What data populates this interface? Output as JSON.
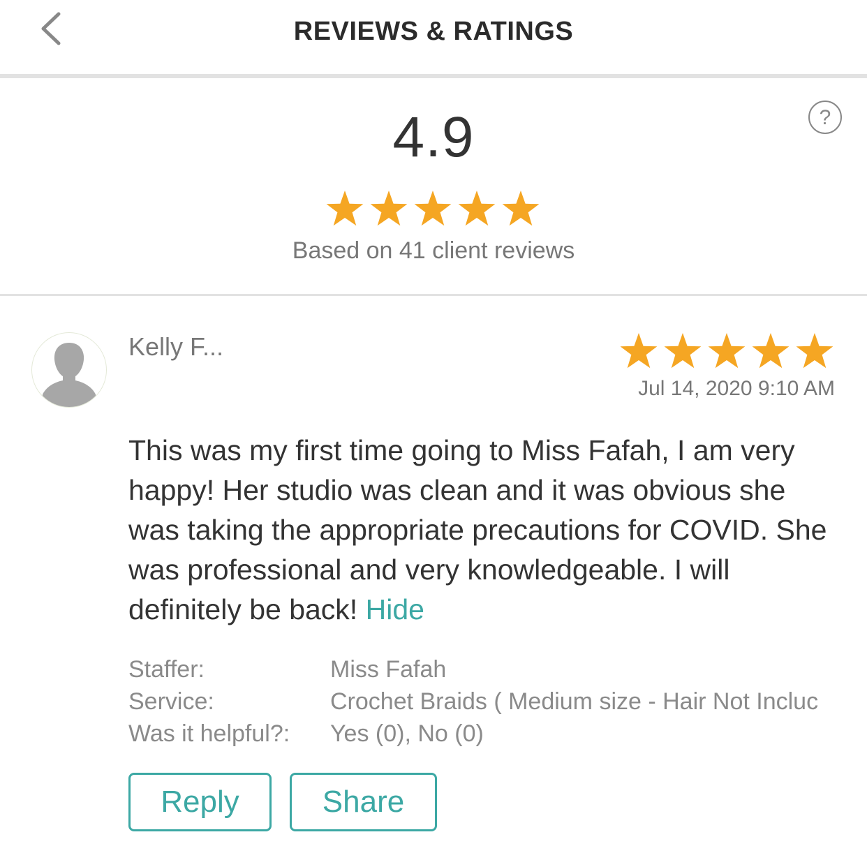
{
  "header": {
    "title": "REVIEWS & RATINGS",
    "back_icon": "chevron-left-icon",
    "title_color": "#2b2b2b"
  },
  "summary": {
    "average_rating": "4.9",
    "stars": 5,
    "caption": "Based on 41 client reviews",
    "help_icon": "question-circle-icon",
    "star_color": "#f5a623"
  },
  "review": {
    "reviewer": "Kelly F...",
    "avatar_icon": "default-avatar-icon",
    "stars": 5,
    "date": "Jul 14, 2020 9:10 AM",
    "body": "This was my first time going to Miss Fafah, I am very happy!  Her studio was clean and it was obvious she was taking the appropriate precautions for COVID.  She was professional and very knowledgeable.  I will definitely be back!",
    "toggle_link": "Hide",
    "details": [
      {
        "label": "Staffer:",
        "value": "Miss Fafah"
      },
      {
        "label": "Service:",
        "value": "Crochet Braids ( Medium size - Hair Not Incluc"
      },
      {
        "label": "Was it helpful?:",
        "value": "Yes (0), No (0)"
      }
    ],
    "actions": {
      "reply": "Reply",
      "share": "Share"
    },
    "accent_color": "#3ca8a4"
  }
}
